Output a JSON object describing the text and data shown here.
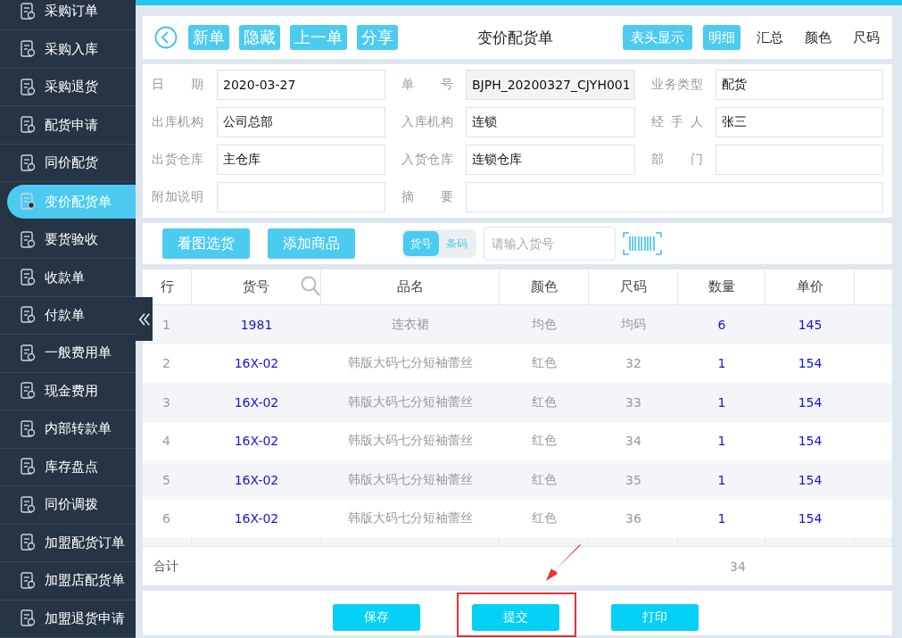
{
  "sidebar": {
    "items": [
      {
        "label": "采购订单",
        "selected": false
      },
      {
        "label": "采购入库",
        "selected": false
      },
      {
        "label": "采购退货",
        "selected": false
      },
      {
        "label": "配货申请",
        "selected": false
      },
      {
        "label": "同价配货",
        "selected": false
      },
      {
        "label": "变价配货单",
        "selected": true
      },
      {
        "label": "要货验收",
        "selected": false
      },
      {
        "label": "收款单",
        "selected": false
      },
      {
        "label": "付款单",
        "selected": false
      },
      {
        "label": "一般费用单",
        "selected": false
      },
      {
        "label": "现金费用",
        "selected": false
      },
      {
        "label": "内部转款单",
        "selected": false
      },
      {
        "label": "库存盘点",
        "selected": false
      },
      {
        "label": "同价调拨",
        "selected": false
      },
      {
        "label": "加盟配货订单",
        "selected": false
      },
      {
        "label": "加盟店配货单",
        "selected": false
      },
      {
        "label": "加盟退货申请",
        "selected": false
      }
    ]
  },
  "toolbar": {
    "buttons": [
      "新单",
      "隐藏",
      "上一单",
      "分享"
    ],
    "title": "变价配货单",
    "header_toggle": "表头显示",
    "view_tabs": [
      {
        "label": "明细",
        "selected": true
      },
      {
        "label": "汇总",
        "selected": false
      },
      {
        "label": "颜色",
        "selected": false
      },
      {
        "label": "尺码",
        "selected": false
      }
    ]
  },
  "form": {
    "fields": [
      {
        "label": "日期",
        "value": "2020-03-27",
        "readonly": false,
        "kind": "normal"
      },
      {
        "label": "单号",
        "value": "BJPH_20200327_CJYH001",
        "readonly": true,
        "kind": "normal"
      },
      {
        "label": "业务类型",
        "value": "配货",
        "readonly": false,
        "kind": "normal"
      },
      {
        "label": "出库机构",
        "value": "公司总部",
        "readonly": false,
        "kind": "normal"
      },
      {
        "label": "入库机构",
        "value": "连锁",
        "readonly": false,
        "kind": "normal"
      },
      {
        "label": "经手人",
        "value": "张三",
        "readonly": false,
        "kind": "normal"
      },
      {
        "label": "出货仓库",
        "value": "主仓库",
        "readonly": false,
        "kind": "normal"
      },
      {
        "label": "入货仓库",
        "value": "连锁仓库",
        "readonly": false,
        "kind": "normal"
      },
      {
        "label": "部门",
        "readonly": false,
        "kind": "normal"
      },
      {
        "label": "附加说明",
        "readonly": false,
        "kind": "normal"
      },
      {
        "label": "摘要",
        "readonly": false,
        "kind": "wide"
      }
    ]
  },
  "actions": {
    "buttons": [
      "看图选货",
      "添加商品"
    ],
    "mode_switch": [
      {
        "label": "货号",
        "selected": true
      },
      {
        "label": "条码",
        "selected": false
      }
    ],
    "search": {
      "placeholder": "请输入货号"
    }
  },
  "table": {
    "columns": [
      "行",
      "货号",
      "品名",
      "颜色",
      "尺码",
      "数量",
      "单价"
    ],
    "rows": [
      [
        "1",
        "1981",
        "连衣裙",
        "均色",
        "均码",
        "6",
        "145"
      ],
      [
        "2",
        "16X-02",
        "韩版大码七分短袖蕾丝",
        "红色",
        "32",
        "1",
        "154"
      ],
      [
        "3",
        "16X-02",
        "韩版大码七分短袖蕾丝",
        "红色",
        "33",
        "1",
        "154"
      ],
      [
        "4",
        "16X-02",
        "韩版大码七分短袖蕾丝",
        "红色",
        "34",
        "1",
        "154"
      ],
      [
        "5",
        "16X-02",
        "韩版大码七分短袖蕾丝",
        "红色",
        "35",
        "1",
        "154"
      ],
      [
        "6",
        "16X-02",
        "韩版大码七分短袖蕾丝",
        "红色",
        "36",
        "1",
        "154"
      ]
    ],
    "total": {
      "label": "合计",
      "quantity": "34"
    }
  },
  "footer": {
    "buttons": [
      {
        "label": "保存",
        "highlighted": false
      },
      {
        "label": "提交",
        "highlighted": true
      },
      {
        "label": "打印",
        "highlighted": false
      }
    ]
  }
}
